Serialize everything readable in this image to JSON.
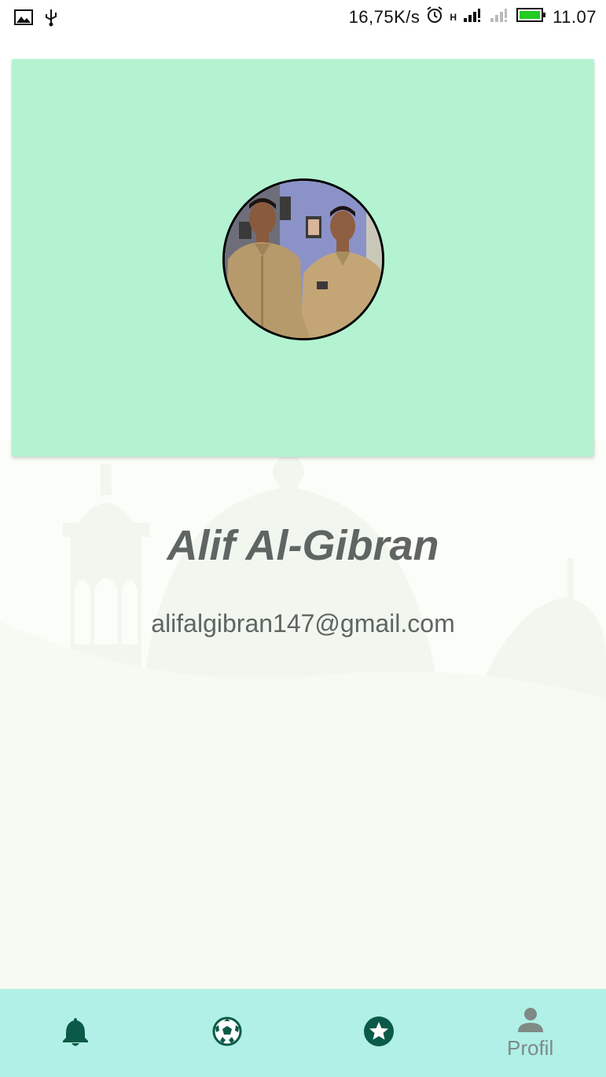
{
  "status_bar": {
    "net_speed": "16,75K/s",
    "network_type": "H",
    "time": "11.07",
    "icons": [
      "image-icon",
      "usb-icon",
      "alarm-icon",
      "signal-icon",
      "signal-empty-icon",
      "battery-icon"
    ]
  },
  "profile": {
    "name": "Alif Al-Gibran",
    "email": "alifalgibran147@gmail.com"
  },
  "bottom_nav": {
    "items": [
      {
        "icon": "bell-icon",
        "label": ""
      },
      {
        "icon": "soccer-ball-icon",
        "label": ""
      },
      {
        "icon": "star-circle-icon",
        "label": ""
      },
      {
        "icon": "person-icon",
        "label": "Profil"
      }
    ],
    "active_index": 3
  },
  "colors": {
    "header_bg": "#b3f3d2",
    "nav_bg": "#b0f0e6",
    "icon_dark_green": "#0b5a48",
    "text_gray": "#5f6562",
    "inactive_icon": "#7f8a87"
  }
}
